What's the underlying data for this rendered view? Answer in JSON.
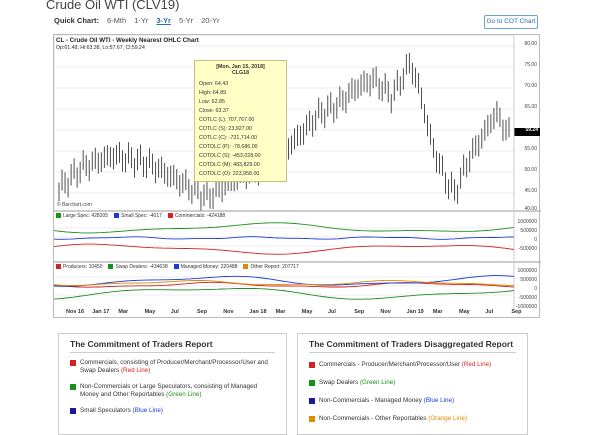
{
  "page": {
    "title": "Crude Oil WTI (CLV19)",
    "quick_label": "Quick Chart:",
    "quick_links": [
      "6-Mth",
      "1-Yr",
      "3-Yr",
      "5-Yr",
      "20-Yr"
    ],
    "active_link": "3-Yr",
    "cot_button": "Go to COT Chart"
  },
  "chart": {
    "title": "CL - Crude Oil WTI - Weekly Nearest OHLC Chart",
    "ohlc_summary": "Op:61.48, Hi:63.38, Lo:57.67, Cl:59.24",
    "attribution": "© Barchart.com",
    "last_price_label": "59.24",
    "price_axis": [
      "80.00",
      "75.00",
      "70.00",
      "65.00",
      "60.00",
      "55.00",
      "50.00",
      "45.00",
      "40.00"
    ],
    "x_labels": [
      "Nov 16",
      "Jan 17",
      "Mar",
      "May",
      "Jul",
      "Sep",
      "Nov",
      "Jan 18",
      "Mar",
      "May",
      "Jul",
      "Sep",
      "Nov",
      "Jan 19",
      "Mar",
      "May",
      "Jul",
      "Sep"
    ],
    "tooltip": {
      "date": "[Mon. Jan 15, 2018]",
      "symbol": "CLG18",
      "lines": [
        "Open: 64.43",
        "High: 64.89",
        "Low: 62.85",
        "Close: 63.37",
        "COTLC (L): 707,767.00",
        "COTLC (S): 23,927.00",
        "COTLC (C): -731,714.00",
        "COTDLC (P): -78,686.00",
        "COTDLC (S): -453,028.00",
        "COTDLC (M): 483,829.00",
        "COTDLC (O): 223,958.00"
      ]
    },
    "legend1": [
      {
        "label": "Large Spec: 428205",
        "color": "#1a8f1a"
      },
      {
        "label": "Small Spec: -4017",
        "color": "#1a3bd8"
      },
      {
        "label": "Commercials: -424188",
        "color": "#d22222"
      }
    ],
    "legend1_axis": [
      "1000000",
      "500000",
      "0",
      "-500000",
      "-1000000"
    ],
    "legend2": [
      {
        "label": "Producers: 10450",
        "color": "#d22222"
      },
      {
        "label": "Swap Dealers: -434638",
        "color": "#1a8f1a"
      },
      {
        "label": "Managed Money: 220488",
        "color": "#1a3bd8"
      },
      {
        "label": "Other Report: 207717",
        "color": "#e08a00"
      }
    ],
    "legend2_axis": [
      "1000000",
      "500000",
      "0",
      "-500000",
      "-1000000"
    ]
  },
  "cot_report": {
    "title": "The Commitment of Traders Report",
    "items": [
      {
        "text": "Commercials, consisting of Producer/Merchant/Processor/User and Swap Dealers",
        "tag": "(Red Line)",
        "color": "#d22222"
      },
      {
        "text": "Non-Commercials or Large Speculators, consisting of Managed Money and Other Reportables",
        "tag": "(Green Line)",
        "color": "#1a8f1a"
      },
      {
        "text": "Small Speculators",
        "tag": "(Blue Line)",
        "color": "#1a1a9a"
      }
    ]
  },
  "cot_disagg": {
    "title": "The Commitment of Traders Disaggregated Report",
    "items": [
      {
        "text": "Commercials - Producer/Merchant/Processor/User",
        "tag": "(Red Line)",
        "color": "#d22222"
      },
      {
        "text": "Swap Dealers",
        "tag": "(Green Line)",
        "color": "#1a8f1a"
      },
      {
        "text": "Non-Commercials - Managed Money",
        "tag": "(Blue Line)",
        "color": "#1a1a9a"
      },
      {
        "text": "Non-Commercials - Other Reportables",
        "tag": "(Orange Line)",
        "color": "#e08a00"
      }
    ]
  }
}
